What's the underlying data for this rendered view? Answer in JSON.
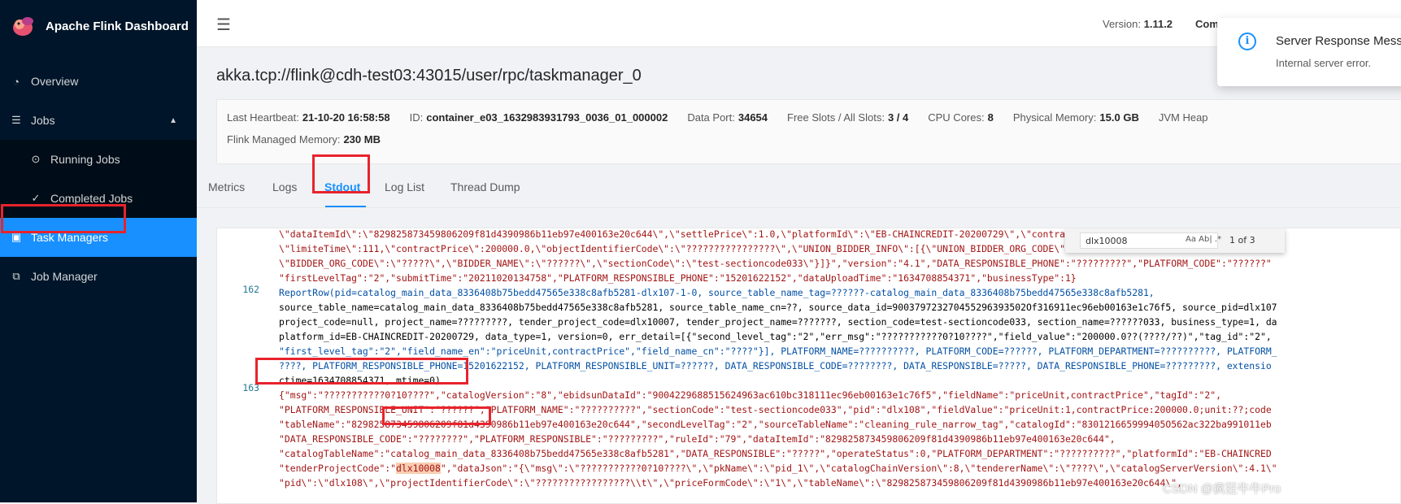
{
  "app": {
    "title": "Apache Flink Dashboard"
  },
  "sidebar": {
    "items": [
      {
        "label": "Overview"
      },
      {
        "label": "Jobs"
      },
      {
        "label": "Running Jobs"
      },
      {
        "label": "Completed Jobs"
      },
      {
        "label": "Task Managers"
      },
      {
        "label": "Job Manager"
      }
    ]
  },
  "header": {
    "version_label": "Version:",
    "version_value": "1.11.2",
    "commit_label": "Com"
  },
  "notification": {
    "title": "Server Response Mess",
    "desc": "Internal server error."
  },
  "page": {
    "title": "akka.tcp://flink@cdh-test03:43015/user/rpc/taskmanager_0",
    "info_row1": [
      {
        "k": "Last Heartbeat:",
        "v": "21-10-20 16:58:58"
      },
      {
        "k": "ID:",
        "v": "container_e03_1632983931793_0036_01_000002"
      },
      {
        "k": "Data Port:",
        "v": "34654"
      },
      {
        "k": "Free Slots / All Slots:",
        "v": "3 / 4"
      },
      {
        "k": "CPU Cores:",
        "v": "8"
      },
      {
        "k": "Physical Memory:",
        "v": "15.0 GB"
      },
      {
        "k": "JVM Heap",
        "v": ""
      }
    ],
    "info_row2": [
      {
        "k": "Flink Managed Memory:",
        "v": "230 MB"
      }
    ]
  },
  "tabs": [
    {
      "label": "Metrics"
    },
    {
      "label": "Logs"
    },
    {
      "label": "Stdout"
    },
    {
      "label": "Log List"
    },
    {
      "label": "Thread Dump"
    }
  ],
  "find": {
    "query": "dlx10008",
    "opts": "Aa  Ab|  .*",
    "count": "1 of 3"
  },
  "editor": {
    "line_numbers": [
      "162",
      "163"
    ],
    "lines": [
      "\\\"dataItemId\\\":\\\"829825873459806209f81d4390986b11eb97e400163e20c644\\\",\\\"settlePrice\\\":1.0,\\\"platformId\\\":\\\"EB-CHAINCREDIT-20200729\\\",\\\"contrac",
      "\\\"limiteTime\\\":111,\\\"contractPrice\\\":200000.0,\\\"objectIdentifierCode\\\":\\\"????????????????\\\",\\\"UNION_BIDDER_INFO\\\":[{\\\"UNION_BIDDER_ORG_CODE\\\":\\",
      "\\\"BIDDER_ORG_CODE\\\":\\\"?????\\\",\\\"BIDDER_NAME\\\":\\\"??????\\\",\\\"sectionCode\\\":\\\"test-sectioncode033\\\"}]}\",\"version\":\"4.1\",\"DATA_RESPONSIBLE_PHONE\":\"?????????\",\"PLATFORM_CODE\":\"??????\"",
      "\"firstLevelTag\":\"2\",\"submitTime\":\"20211020134758\",\"PLATFORM_RESPONSIBLE_PHONE\":\"15201622152\",\"dataUploadTime\":\"1634708854371\",\"businessType\":1}",
      "ReportRow(pid=catalog_main_data_8336408b75bedd47565e338c8afb5281-dlx107-1-0, source_table_name_tag=??????-catalog_main_data_8336408b75bedd47565e338c8afb5281,",
      "source_table_name=catalog_main_data_8336408b75bedd47565e338c8afb5281, source_table_name_cn=??, source_data_id=900379723270455296393502Of316911ec96eb00163e1c76f5, source_pid=dlx107",
      "project_code=null, project_name=?????????, tender_project_code=dlx10007, tender_project_name=???????, section_code=test-sectioncode033, section_name=??????033, business_type=1, da",
      "platform_id=EB-CHAINCREDIT-20200729, data_type=1, version=0, err_detail=[{\"second_level_tag\":\"2\",\"err_msg\":\"???????????0?10????\",\"field_value\":\"200000.0??(????/??)\",\"tag_id\":\"2\",",
      "\"first_level_tag\":\"2\",\"field_name_en\":\"priceUnit,contractPrice\",\"field_name_cn\":\"????\"}], PLATFORM_NAME=??????????, PLATFORM_CODE=??????, PLATFORM_DEPARTMENT=??????????, PLATFORM_",
      "????, PLATFORM_RESPONSIBLE_PHONE=15201622152, PLATFORM_RESPONSIBLE_UNIT=??????, DATA_RESPONSIBLE_CODE=????????, DATA_RESPONSIBLE=?????, DATA_RESPONSIBLE_PHONE=?????????, extensio",
      "ctime=1634708854371, mtime=0)",
      "{\"msg\":\"???????????0?10????\",\"catalogVersion\":\"8\",\"ebidsunDataId\":\"9004229688515624963ac610bc318111ec96eb00163e1c76f5\",\"fieldName\":\"priceUnit,contractPrice\",\"tagId\":\"2\",",
      "\"PLATFORM_RESPONSIBLE_UNIT\":\"??????\",\"PLATFORM_NAME\":\"??????????\",\"sectionCode\":\"test-sectioncode033\",\"pid\":\"dlx108\",\"fieldValue\":\"priceUnit:1,contractPrice:200000.0;unit:??;code",
      "\"tableName\":\"829825873459806209f81d4390986b11eb97e400163e20c644\",\"secondLevelTag\":\"2\",\"sourceTableName\":\"cleaning_rule_narrow_tag\",\"catalogId\":\"830121665999405O562ac322ba991011eb",
      "\"DATA_RESPONSIBLE_CODE\":\"????????\",\"PLATFORM_RESPONSIBLE\":\"?????????\",\"ruleId\":\"79\",\"dataItemId\":\"829825873459806209f81d4390986b11eb97e400163e20c644\",",
      "\"catalogTableName\":\"catalog_main_data_8336408b75bedd47565e338c8afb5281\",\"DATA_RESPONSIBLE\":\"?????\",\"operateStatus\":0,\"PLATFORM_DEPARTMENT\":\"??????????\",\"platformId\":\"EB-CHAINCRED",
      "\"tenderProjectCode\":\"",
      "\"pid\\\":\\\"dlx108\\\",\\\"projectIdentifierCode\\\":\\\"?????????????????\\\\t\\\",\\\"priceFormCode\\\":\\\"1\\\",\\\"tableName\\\":\\\"829825873459806209f81d4390986b11eb97e400163e20c644\\\","
    ],
    "highlight": "dlx10008",
    "after_highlight": "\",\"dataJson\":\"{\\\"msg\\\":\\\"???????????0?10????\\\",\\\"pkName\\\":\\\"pid_1\\\",\\\"catalogChainVersion\\\":8,\\\"tendererName\\\":\\\"????\\\",\\\"catalogServerVersion\\\":4.1\\\""
  },
  "watermark": "CSDN @疯狂牛牛Pro"
}
